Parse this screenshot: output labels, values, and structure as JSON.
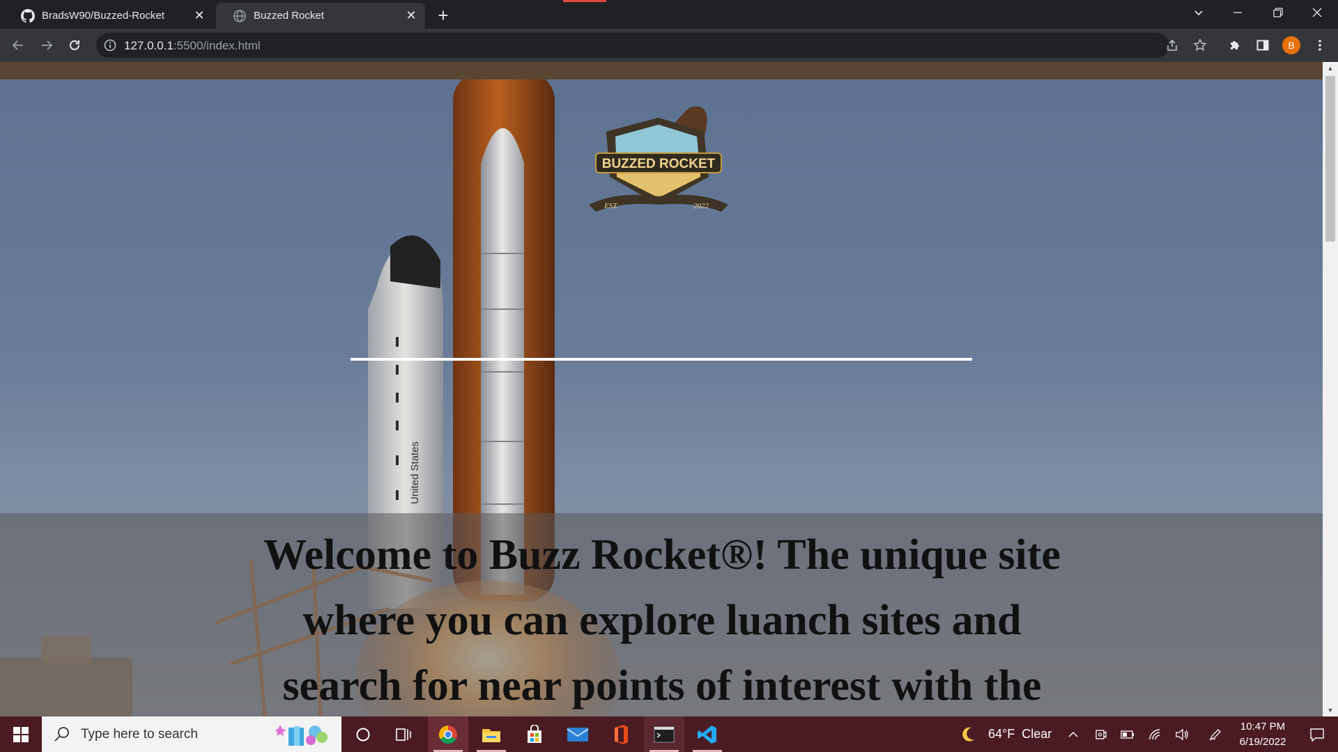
{
  "browser": {
    "tabs": [
      {
        "title": "BradsW90/Buzzed-Rocket",
        "icon": "github-icon",
        "active": false
      },
      {
        "title": "Buzzed Rocket",
        "icon": "globe-icon",
        "active": true
      }
    ],
    "url_host": "127.0.0.1",
    "url_rest": ":5500/index.html",
    "profile_initial": "B"
  },
  "page": {
    "logo_title": "BUZZED ROCKET",
    "logo_est": "EST.",
    "logo_year": "2022",
    "welcome_text": "Welcome to Buzz Rocket®! The unique site where you can explore luanch sites and search for near points of interest with the",
    "colors": {
      "nav_strip": "#5a4532",
      "divider": "#ffffff",
      "sky": "#5d7291"
    }
  },
  "taskbar": {
    "search_placeholder": "Type here to search",
    "weather_temp": "64°F",
    "weather_desc": "Clear",
    "time": "10:47 PM",
    "date": "6/19/2022",
    "apps": [
      "cortana-icon",
      "task-view-icon",
      "chrome-icon",
      "file-explorer-icon",
      "microsoft-store-icon",
      "mail-icon",
      "office-icon",
      "terminal-icon",
      "vscode-icon"
    ]
  }
}
